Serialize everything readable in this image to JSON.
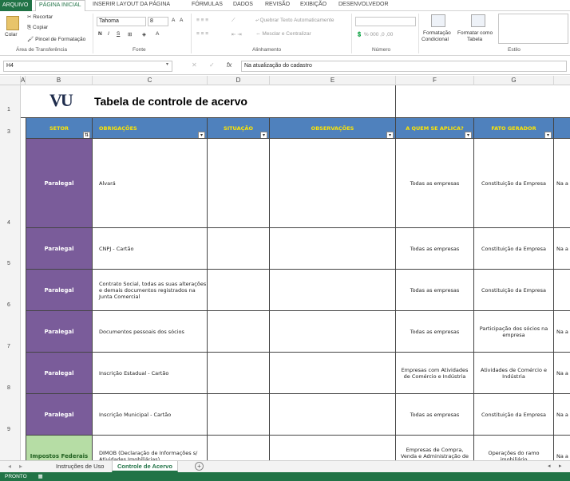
{
  "ribbon_tabs": [
    "ARQUIVO",
    "PÁGINA INICIAL",
    "INSERIR",
    "LAYOUT DA PÁGINA",
    "FÓRMULAS",
    "DADOS",
    "REVISÃO",
    "EXIBIÇÃO",
    "DESENVOLVEDOR"
  ],
  "ribbon": {
    "paste": "Colar",
    "cut": "Recortar",
    "copy": "Copiar",
    "format_painter": "Pincel de Formatação",
    "clipboard_group": "Área de Transferência",
    "font_name": "Tahoma",
    "font_size": "8",
    "font_group": "Fonte",
    "wrap_text": "Quebrar Texto Automaticamente",
    "merge_center": "Mesclar e Centralizar",
    "alignment_group": "Alinhamento",
    "number_group": "Número",
    "cond_format_1": "Formatação",
    "cond_format_2": "Condicional",
    "format_table_1": "Formatar como",
    "format_table_2": "Tabela",
    "styles_group": "Estilo"
  },
  "formula_bar": {
    "name_box": "H4",
    "fx": "fx",
    "formula": "Na atualização do cadastro"
  },
  "columns": [
    "A",
    "B",
    "C",
    "D",
    "E",
    "F",
    "G"
  ],
  "rows": [
    "1",
    "3",
    "4",
    "5",
    "6",
    "7",
    "8",
    "9"
  ],
  "sheet": {
    "logo_text": "VU",
    "title": "Tabela de controle de acervo",
    "headers": [
      "SETOR",
      "OBRIGAÇÕES",
      "SITUAÇÃO",
      "OBSERVAÇÕES",
      "A QUEM SE APLICA?",
      "FATO GERADOR"
    ],
    "data_rows": [
      {
        "setor": "Paralegal",
        "obrigacao": "Alvará",
        "aplica": "Todas as empresas",
        "fato": "Constituição da Empresa",
        "h": "Na a"
      },
      {
        "setor": "Paralegal",
        "obrigacao": "CNPJ - Cartão",
        "aplica": "Todas as empresas",
        "fato": "Constituição da Empresa",
        "h": "Na a"
      },
      {
        "setor": "Paralegal",
        "obrigacao": "Contrato Social, todas as suas alterações e demais documentos registrados na Junta Comercial",
        "aplica": "Todas as empresas",
        "fato": "Constituição da Empresa",
        "h": ""
      },
      {
        "setor": "Paralegal",
        "obrigacao": "Documentos pessoais dos sócios",
        "aplica": "Todas as empresas",
        "fato": "Participação dos sócios na empresa",
        "h": "Na a"
      },
      {
        "setor": "Paralegal",
        "obrigacao": "Inscrição Estadual - Cartão",
        "aplica": "Empresas com Atividades de Comércio e Indústria",
        "fato": "Atividades de Comércio e Indústria",
        "h": "Na a"
      },
      {
        "setor": "Paralegal",
        "obrigacao": "Inscrição Municipal - Cartão",
        "aplica": "Todas as empresas",
        "fato": "Constituição da Empresa",
        "h": "Na a"
      },
      {
        "setor": "Impostos Federais",
        "obrigacao": "DIMOB (Declaração de Informações s/ Atividades Imobiliárias)",
        "aplica": "Empresas de Compra, Venda e Administração de Imóveis",
        "fato": "Operações do ramo imobiliário",
        "h": "Na a"
      }
    ]
  },
  "sheet_tabs": [
    "Instruções de Uso",
    "Controle de Acervo"
  ],
  "status": "PRONTO",
  "colors": {
    "accent": "#217346",
    "header_blue": "#4f81bd",
    "header_text": "#ffe600",
    "setor_purple": "#7a5c9a",
    "setor_green": "#b6dda5"
  }
}
